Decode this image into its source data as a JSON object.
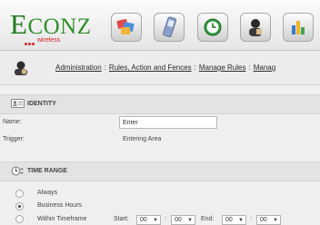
{
  "brand": {
    "name_cap": "E",
    "name_rest": "CONZ",
    "sub": "wireless",
    "color": "#2e8f2a"
  },
  "header_buttons": [
    {
      "icon": "tags-icon"
    },
    {
      "icon": "phone-icon"
    },
    {
      "icon": "clock-icon"
    },
    {
      "icon": "person-icon"
    },
    {
      "icon": "chart-icon"
    }
  ],
  "breadcrumb": {
    "items": [
      "Administration",
      "Rules, Action and Fences",
      "Manage Rules",
      "Manag"
    ],
    "separator": ":"
  },
  "identity": {
    "title": "IDENTITY",
    "name_label": "Name:",
    "name_value": "Enter",
    "trigger_label": "Trigger:",
    "trigger_value": "Entering Area"
  },
  "time_range": {
    "title": "TIME RANGE",
    "options": [
      {
        "label": "Always",
        "checked": false
      },
      {
        "label": "Business Hours",
        "checked": true
      },
      {
        "label": "Within Timeframe",
        "checked": false
      }
    ],
    "start_label": "Start:",
    "end_label": "End:",
    "start_hour": "00",
    "start_min": "00",
    "end_hour": "00",
    "end_min": "00",
    "colon": ":"
  }
}
